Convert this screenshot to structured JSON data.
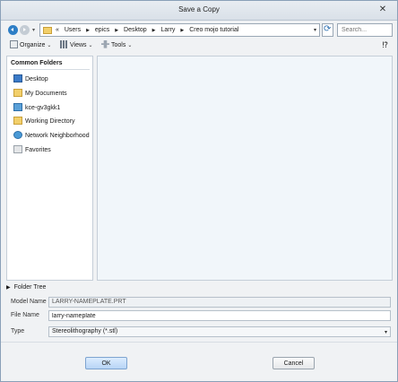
{
  "window": {
    "title": "Save a Copy",
    "close_glyph": "✕"
  },
  "address": {
    "prefix": "«",
    "segments": [
      "Users",
      "epics",
      "Desktop",
      "Larry",
      "Creo mojo tutorial"
    ],
    "separator": "▶",
    "dropdown_glyph": "▾"
  },
  "search": {
    "placeholder": "Search..."
  },
  "toolbar": {
    "organize_label": "Organize",
    "views_label": "Views",
    "tools_label": "Tools",
    "chevron": "⌄",
    "help_glyph": "⁉"
  },
  "sidebar": {
    "heading": "Common Folders",
    "items": [
      {
        "label": "Desktop",
        "icon": "desktop-icon"
      },
      {
        "label": "My Documents",
        "icon": "documents-folder-icon"
      },
      {
        "label": "kce-gv3gkk1",
        "icon": "computer-icon"
      },
      {
        "label": "Working Directory",
        "icon": "working-directory-icon"
      },
      {
        "label": "Network Neighborhood",
        "icon": "network-icon"
      },
      {
        "label": "Favorites",
        "icon": "favorites-icon"
      }
    ],
    "folder_tree_label": "Folder Tree",
    "folder_tree_glyph": "▶"
  },
  "form": {
    "model_name_label": "Model Name",
    "model_name_value": "LARRY-NAMEPLATE.PRT",
    "file_name_label": "File Name",
    "file_name_value": "larry-nameplate",
    "type_label": "Type",
    "type_value": "Stereolithography (*.stl)",
    "type_dropdown_glyph": "▾"
  },
  "buttons": {
    "ok_label": "OK",
    "cancel_label": "Cancel"
  },
  "colors": {
    "accent": "#2f7fc6",
    "panel": "#f1f6fa",
    "ok_button": "#b7d4f5"
  }
}
